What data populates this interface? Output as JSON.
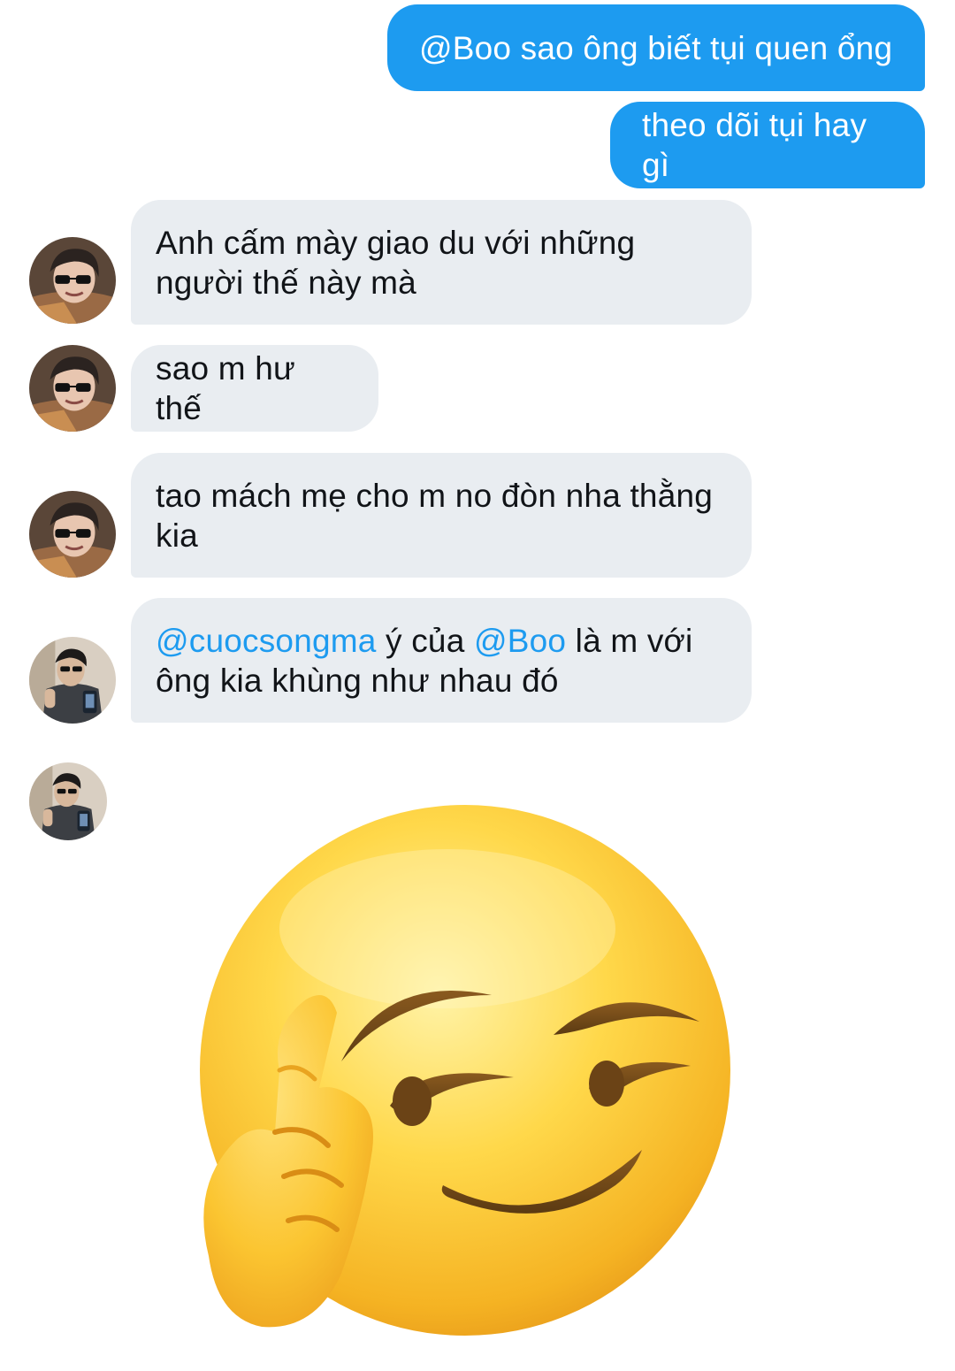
{
  "conversation": {
    "messages": [
      {
        "direction": "outgoing",
        "text": "@Boo sao ông biết tụi quen ổng"
      },
      {
        "direction": "outgoing",
        "text": "theo dõi tụi hay gì"
      },
      {
        "direction": "incoming",
        "sender": "user-a",
        "text": "Anh cấm mày giao du với những người thế này mà"
      },
      {
        "direction": "incoming",
        "sender": "user-a",
        "text": "sao m hư thế"
      },
      {
        "direction": "incoming",
        "sender": "user-a",
        "text": "tao mách mẹ cho m no đòn nha thằng kia"
      },
      {
        "direction": "incoming",
        "sender": "user-b",
        "mention_1": "@cuocsongma",
        "text_1": " ý của ",
        "mention_2": "@Boo",
        "text_2": " là m với ông kia khùng như nhau đó"
      },
      {
        "direction": "incoming",
        "sender": "user-b",
        "sticker": "smirking-face-saluting-emoji"
      }
    ]
  },
  "colors": {
    "outgoing_bubble": "#1d9bf0",
    "incoming_bubble": "#e9edf1",
    "mention": "#1d9bf0",
    "background": "#ffffff"
  }
}
